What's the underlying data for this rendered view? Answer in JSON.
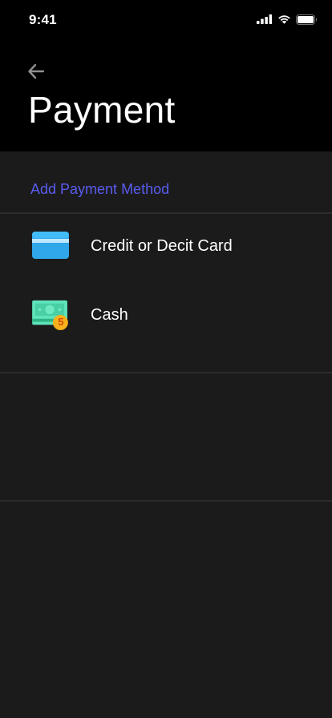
{
  "status_bar": {
    "time": "9:41",
    "icons": [
      "signal-icon",
      "wifi-icon",
      "battery-icon"
    ]
  },
  "header": {
    "back_icon": "arrow-left-icon",
    "title": "Payment"
  },
  "section": {
    "add_method_label": "Add Payment Method",
    "accent_color": "#5a5cf0"
  },
  "payment_methods": [
    {
      "label": "Credit or Decit Card",
      "icon": "credit-card-icon"
    },
    {
      "label": "Cash",
      "icon": "cash-icon",
      "badge": "5"
    }
  ]
}
